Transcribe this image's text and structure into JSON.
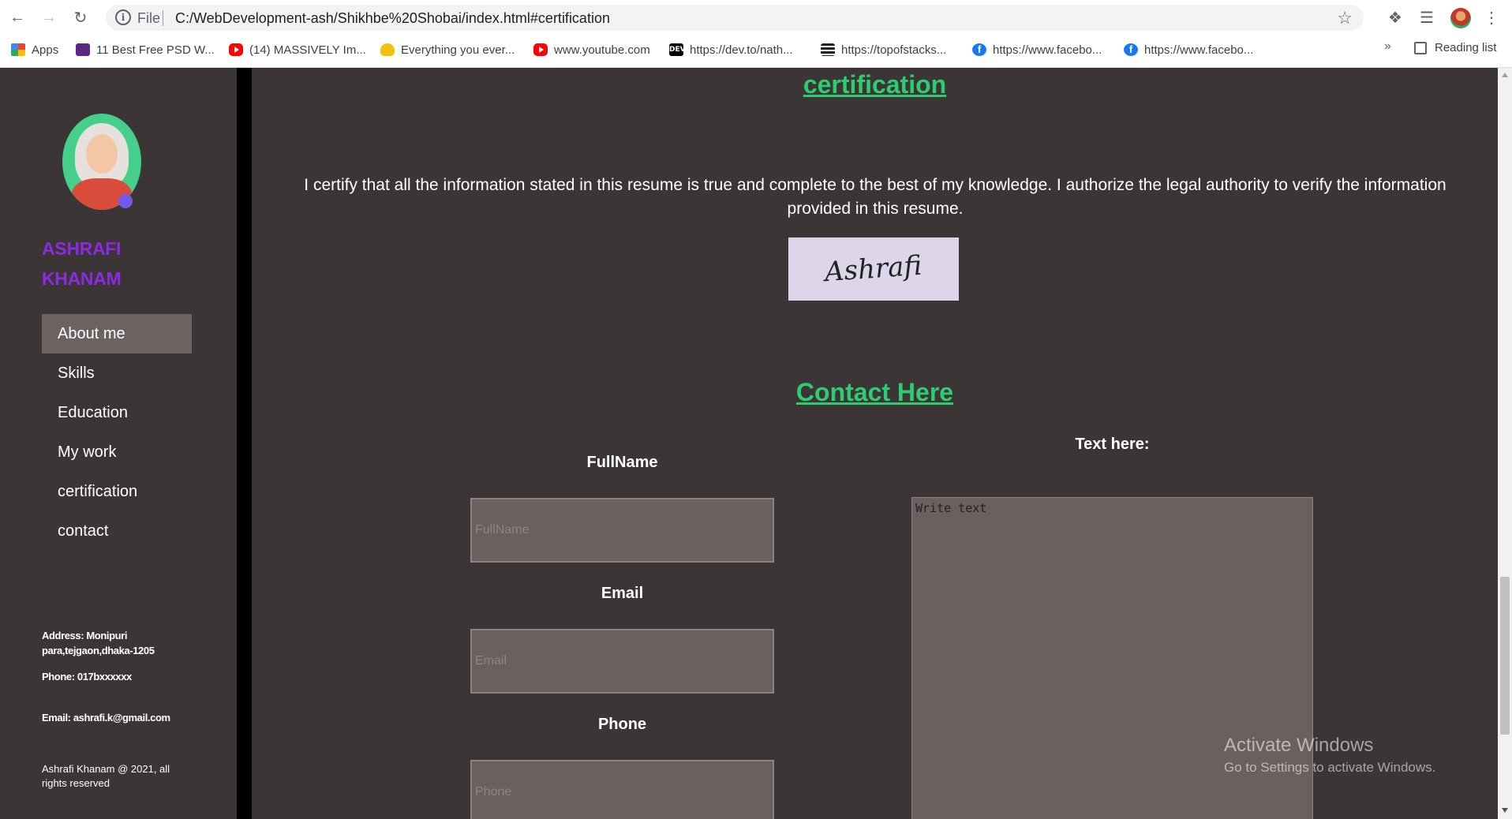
{
  "browser": {
    "file_label": "File",
    "url": "C:/WebDevelopment-ash/Shikhbe%20Shobai/index.html#certification",
    "bookmarks": [
      {
        "label": "Apps",
        "icon": "apps-icon"
      },
      {
        "label": "11 Best Free PSD W...",
        "icon": "psd-site-icon"
      },
      {
        "label": "(14) MASSIVELY Im...",
        "icon": "youtube-icon"
      },
      {
        "label": "Everything you ever...",
        "icon": "bulb-icon"
      },
      {
        "label": "www.youtube.com",
        "icon": "youtube-icon"
      },
      {
        "label": "https://dev.to/nath...",
        "icon": "dev-icon"
      },
      {
        "label": "https://topofstacks...",
        "icon": "stack-icon"
      },
      {
        "label": "https://www.facebo...",
        "icon": "facebook-icon"
      },
      {
        "label": "https://www.facebo...",
        "icon": "facebook-icon"
      }
    ],
    "more": "»",
    "reading_list": "Reading list"
  },
  "sidebar": {
    "name": "ASHRAFI KHANAM",
    "menu": [
      {
        "label": "About me",
        "active": true
      },
      {
        "label": "Skills"
      },
      {
        "label": "Education"
      },
      {
        "label": "My work"
      },
      {
        "label": "certification"
      },
      {
        "label": "contact"
      }
    ],
    "address": "Address: Monipuri para,tejgaon,dhaka-1205",
    "phone": "Phone: 017bxxxxxx",
    "email": "Email: ashrafi.k@gmail.com",
    "copyright": "Ashrafi Khanam @ 2021, all rights reserved"
  },
  "main": {
    "cert_heading": "certification",
    "cert_text": "I certify that all the information stated in this resume is true and complete to the best of my knowledge. I authorize the legal authority to verify the information provided in this resume.",
    "signature": "Ashrafi",
    "contact_heading": "Contact Here",
    "form": {
      "fullname_label": "FullName",
      "fullname_placeholder": "FullName",
      "email_label": "Email",
      "email_placeholder": "Email",
      "phone_label": "Phone",
      "phone_placeholder": "Phone",
      "text_label": "Text here:",
      "text_placeholder": "Write text"
    }
  },
  "watermark": {
    "title": "Activate Windows",
    "subtitle": "Go to Settings to activate Windows."
  },
  "colors": {
    "accent_green": "#2ecc71",
    "brand_purple": "#8a2be2",
    "background": "#3c3535"
  }
}
